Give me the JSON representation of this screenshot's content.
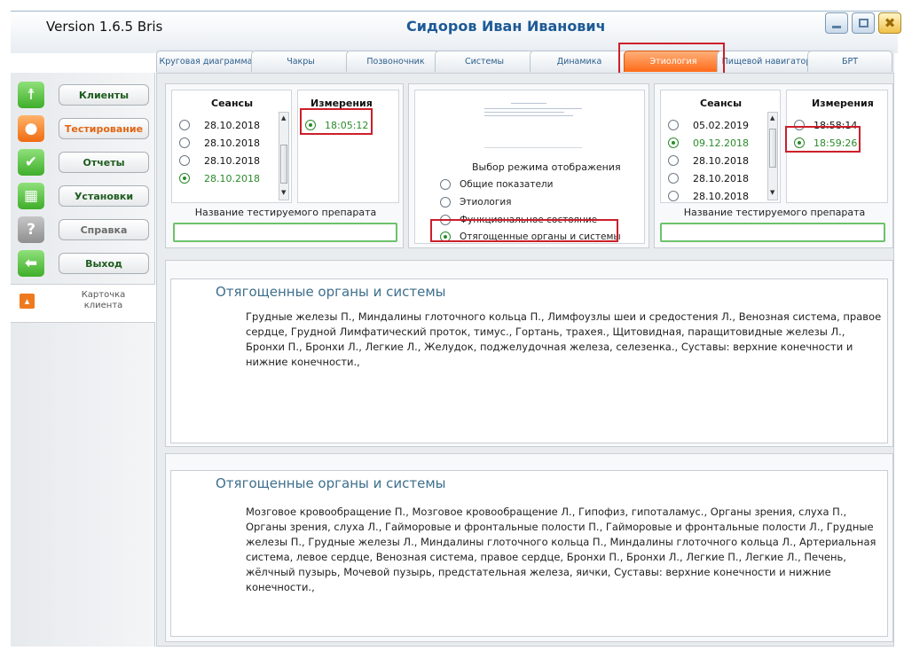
{
  "titlebar": {
    "version": "Version 1.6.5 Bris",
    "user_name": "Сидоров Иван Иванович",
    "close_glyph": "✖"
  },
  "tabs": [
    {
      "label": "Круговая диаграмма",
      "active": false
    },
    {
      "label": "Чакры",
      "active": false
    },
    {
      "label": "Позвоночник",
      "active": false
    },
    {
      "label": "Системы",
      "active": false
    },
    {
      "label": "Динамика",
      "active": false
    },
    {
      "label": "Этиология",
      "active": true
    },
    {
      "label": "Пищевой навигатор",
      "active": false
    },
    {
      "label": "БРТ",
      "active": false
    }
  ],
  "sidebar": {
    "items": [
      {
        "label": "Клиенты",
        "icon": "person-icon",
        "glyph": "☨"
      },
      {
        "label": "Тестирование",
        "icon": "user-icon",
        "glyph": "●"
      },
      {
        "label": "Отчеты",
        "icon": "check-icon",
        "glyph": "✔"
      },
      {
        "label": "Установки",
        "icon": "settings-grid-icon",
        "glyph": "▦"
      },
      {
        "label": "Справка",
        "icon": "help-icon",
        "glyph": "?"
      },
      {
        "label": "Выход",
        "icon": "exit-arrow-icon",
        "glyph": "⬅"
      }
    ],
    "card_label": "Карточка клиента"
  },
  "left_panel": {
    "sessions_header": "Сеансы",
    "measurements_header": "Измерения",
    "sessions": [
      {
        "date": "28.10.2018",
        "selected": false
      },
      {
        "date": "28.10.2018",
        "selected": false
      },
      {
        "date": "28.10.2018",
        "selected": false
      },
      {
        "date": "28.10.2018",
        "selected": true
      }
    ],
    "measurements": [
      {
        "time": "18:05:12",
        "selected": true
      }
    ],
    "drug_label": "Название тестируемого препарата",
    "drug_value": ""
  },
  "center_panel": {
    "mode_title": "Выбор режима отображения",
    "modes": [
      {
        "label": "Общие показатели",
        "selected": false
      },
      {
        "label": "Этиология",
        "selected": false
      },
      {
        "label": "Функциональное состояние",
        "selected": false
      },
      {
        "label": "Отягощенные органы и системы",
        "selected": true
      }
    ]
  },
  "right_panel": {
    "sessions_header": "Сеансы",
    "measurements_header": "Измерения",
    "sessions": [
      {
        "date": "05.02.2019",
        "selected": false
      },
      {
        "date": "09.12.2018",
        "selected": true
      },
      {
        "date": "28.10.2018",
        "selected": false
      },
      {
        "date": "28.10.2018",
        "selected": false
      },
      {
        "date": "28.10.2018",
        "selected": false
      }
    ],
    "measurements": [
      {
        "time": "18:58:14",
        "selected": false
      },
      {
        "time": "18:59:26",
        "selected": true
      }
    ],
    "drug_label": "Название тестируемого препарата",
    "drug_value": ""
  },
  "results": [
    {
      "heading": "Отягощенные органы и системы",
      "text": "Грудные железы П., Миндалины глоточного кольца П., Лимфоузлы шеи и средостения Л., Венозная система, правое сердце, Грудной Лимфатический проток, тимус., Гортань, трахея., Щитовидная, паращитовидные железы Л., Бронхи П., Бронхи Л., Легкие Л., Желудок, поджелудочная железа, селезенка., Суставы: верхние конечности и нижние конечности.,"
    },
    {
      "heading": "Отягощенные органы и системы",
      "text": "Мозговое кровообращение П., Мозговое кровообращение Л., Гипофиз, гипоталамус., Органы зрения, слуха П., Органы зрения, слуха Л., Гайморовые и фронтальные полости П., Гайморовые и фронтальные полости Л., Грудные железы П., Грудные железы Л., Миндалины глоточного кольца П., Миндалины глоточного кольца Л., Артериальная система, левое сердце, Венозная система, правое сердце, Бронхи П., Бронхи Л., Легкие П., Легкие Л., Печень, жёлчный пузырь, Мочевой пузырь, предстательная железа, яички, Суставы: верхние конечности и нижние конечности.,"
    }
  ],
  "colors": {
    "accent_orange": "#ff6a18",
    "title_blue": "#1d5a96",
    "highlight_red": "#cc1f2a",
    "selected_green": "#2b8a2b"
  }
}
